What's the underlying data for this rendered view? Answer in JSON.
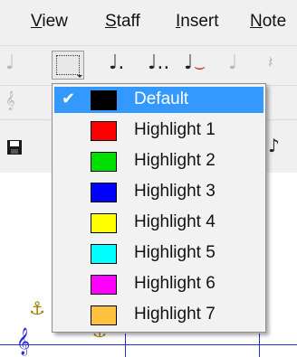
{
  "menubar": {
    "items": [
      {
        "accel": "V",
        "rest": "iew"
      },
      {
        "accel": "S",
        "rest": "taff"
      },
      {
        "accel": "I",
        "rest": "nsert"
      },
      {
        "accel": "N",
        "rest": "ote"
      }
    ]
  },
  "toolbar": {
    "icons": {
      "quarter_note": "♩",
      "dotted_note": "♩.",
      "double_dotted_note": "♩..",
      "tie_note": "♩",
      "tie_arc": "⌣",
      "grace_note": "♩",
      "rest_symbol": "𝄽",
      "clef_symbol": "𝄞",
      "save_icon": "💾",
      "anchor_icon": "⚓",
      "treble_clef": "𝄞"
    }
  },
  "color_menu": {
    "selected_index": 0,
    "check_mark": "✔",
    "items": [
      {
        "label": "Default",
        "color": "#000000"
      },
      {
        "label": "Highlight 1",
        "color": "#ff0000"
      },
      {
        "label": "Highlight 2",
        "color": "#00e000"
      },
      {
        "label": "Highlight 3",
        "color": "#0000ff"
      },
      {
        "label": "Highlight 4",
        "color": "#ffff00"
      },
      {
        "label": "Highlight 5",
        "color": "#00ffff"
      },
      {
        "label": "Highlight 6",
        "color": "#ff00ff"
      },
      {
        "label": "Highlight 7",
        "color": "#ffc040"
      }
    ]
  },
  "colors": {
    "menu_highlight": "#3399ff",
    "staff_line": "#2b2ed0",
    "anchor": "#a08000"
  }
}
